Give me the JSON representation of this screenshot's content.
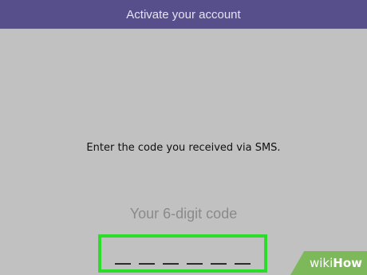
{
  "header": {
    "title": "Activate your account"
  },
  "main": {
    "instruction": "Enter the code you received via SMS.",
    "code_label": "Your 6-digit code",
    "code_slots": [
      "",
      "",
      "",
      "",
      "",
      ""
    ],
    "highlight_color": "#2bdc2b"
  },
  "watermark": {
    "brand_part1": "wiki",
    "brand_part2": "How"
  },
  "colors": {
    "header_bg": "#574f8c",
    "page_bg": "#c1c1c1",
    "watermark_bg": "#7db85a"
  }
}
